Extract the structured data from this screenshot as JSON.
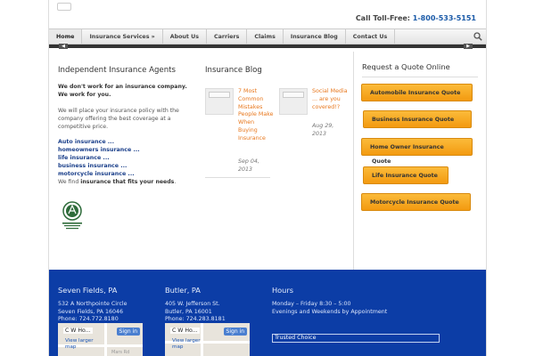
{
  "header": {
    "toll_free_label": "Call Toll-Free:",
    "phone": "1-800-533-5151"
  },
  "nav": {
    "items": [
      {
        "label": "Home"
      },
      {
        "label": "Insurance Services »"
      },
      {
        "label": "About Us"
      },
      {
        "label": "Carriers"
      },
      {
        "label": "Claims"
      },
      {
        "label": "Insurance Blog"
      },
      {
        "label": "Contact Us"
      }
    ],
    "active": "Home"
  },
  "intro": {
    "title": "Independent Insurance Agents",
    "bold_line1": "We don't work for an insurance company.",
    "bold_line2": "We work for you.",
    "paragraph": "We will place your insurance policy with the company offering the best coverage at a competitive price.",
    "links": [
      "Auto insurance ...",
      "homeowners insurance ...",
      "life insurance ...",
      "business insurance ...",
      "motorcycle insurance ..."
    ],
    "find_prefix": "We find ",
    "find_bold": "insurance that fits your needs",
    "find_suffix": "."
  },
  "blog": {
    "title": "Insurance Blog",
    "posts": [
      {
        "title": "7 Most Common Mistakes People Make When Buying Insurance",
        "date": "Sep 04, 2013"
      },
      {
        "title": "Social Media ... are you covered!?",
        "date": "Aug 29, 2013"
      }
    ]
  },
  "quote": {
    "title": "Request a Quote Online",
    "buttons": [
      "Automobile Insurance Quote",
      "Business Insurance Quote",
      "Home Owner Insurance",
      "Life Insurance Quote",
      "Motorcycle Insurance Quote"
    ],
    "home_owner_tail": "Quote"
  },
  "footer": {
    "offices": [
      {
        "city": "Seven Fields, PA",
        "address": "532 A Northpointe Circle",
        "citystate": "Seven Fields, PA 16046",
        "phone": "Phone: 724.772.8180",
        "map_label": "C W Ho...",
        "map_signin": "Sign in",
        "map_link1": "View larger",
        "map_link2": "map"
      },
      {
        "city": "Butler, PA",
        "address": "405 W. Jefferson St.",
        "citystate": "Butler, PA 16001",
        "phone": "Phone: 724.283.8181",
        "map_label": "C W Ho...",
        "map_signin": "Sign in",
        "map_link1": "View larger",
        "map_link2": "map"
      }
    ],
    "map_street": "Mars Rd",
    "hours": {
      "title": "Hours",
      "line1": "Monday – Friday 8:30 – 5:00",
      "line2": "Evenings and Weekends by Appointment",
      "trusted": "Trusted Choice"
    }
  },
  "colors": {
    "nav_bg": "#ececec",
    "footer_bg": "#0c3da6",
    "quote_button": "#f7a81f",
    "blog_link": "#e8781e",
    "phone_link": "#1a5aa8"
  }
}
